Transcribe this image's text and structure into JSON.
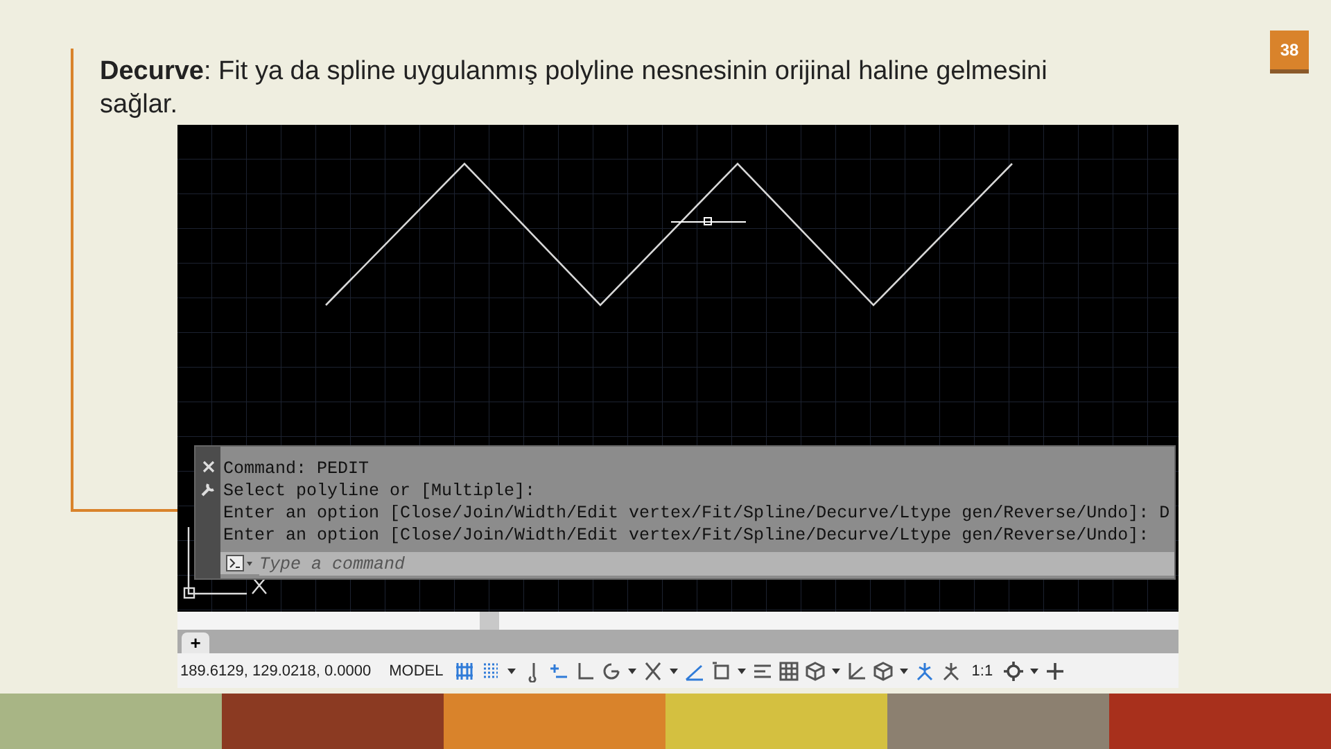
{
  "slide": {
    "number": "38",
    "text": "**Decurve**: Fit ya da spline uygulanmış polyline nesnesinin orijinal haline gelmesini sağlar."
  },
  "cad": {
    "command_history": [
      "Command: PEDIT",
      "Select polyline or [Multiple]:",
      "Enter an option [Close/Join/Width/Edit vertex/Fit/Spline/Decurve/Ltype gen/Reverse/Undo]: D",
      "Enter an option [Close/Join/Width/Edit vertex/Fit/Spline/Decurve/Ltype gen/Reverse/Undo]:"
    ],
    "command_placeholder": "Type a command",
    "add_tab": "+",
    "coordinates": "189.6129, 129.0218, 0.0000",
    "space": "MODEL",
    "scale": "1:1",
    "status_tools": [
      {
        "kind": "grid",
        "on": true
      },
      {
        "kind": "dots",
        "on": true
      },
      {
        "kind": "caret",
        "on": false
      },
      {
        "kind": "note",
        "on": false
      },
      {
        "kind": "dyn",
        "on": true
      },
      {
        "kind": "ortho",
        "on": false
      },
      {
        "kind": "circle",
        "on": false
      },
      {
        "kind": "caret",
        "on": false
      },
      {
        "kind": "cross",
        "on": false
      },
      {
        "kind": "caret",
        "on": false
      },
      {
        "kind": "angle",
        "on": true
      },
      {
        "kind": "box",
        "on": false
      },
      {
        "kind": "caret",
        "on": false
      },
      {
        "kind": "lines",
        "on": false
      },
      {
        "kind": "checker",
        "on": false
      },
      {
        "kind": "cube",
        "on": false
      },
      {
        "kind": "caret",
        "on": false
      },
      {
        "kind": "axes",
        "on": false
      },
      {
        "kind": "cube",
        "on": false
      },
      {
        "kind": "caret",
        "on": false
      },
      {
        "kind": "figure",
        "on": true
      },
      {
        "kind": "figure",
        "on": false
      }
    ],
    "tail_tools": [
      {
        "kind": "gear",
        "on": false
      },
      {
        "kind": "caret",
        "on": false
      },
      {
        "kind": "plus",
        "on": false
      }
    ]
  }
}
